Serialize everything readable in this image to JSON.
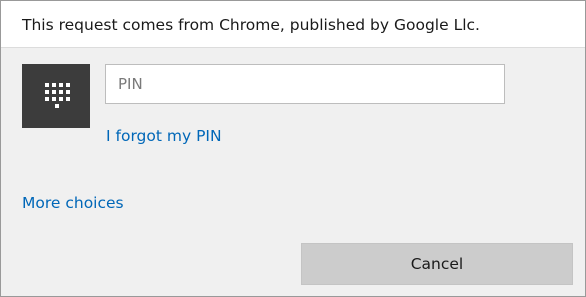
{
  "header": {
    "text": "This request comes from Chrome, published by Google Llc."
  },
  "pin_tile": {
    "icon": "keypad-icon",
    "background_color": "#3c3c3c",
    "icon_color": "#ffffff"
  },
  "pin_input": {
    "placeholder": "PIN",
    "value": ""
  },
  "links": {
    "forgot_pin": "I forgot my PIN",
    "more_choices": "More choices",
    "color": "#0067b8"
  },
  "buttons": {
    "cancel_label": "Cancel"
  }
}
